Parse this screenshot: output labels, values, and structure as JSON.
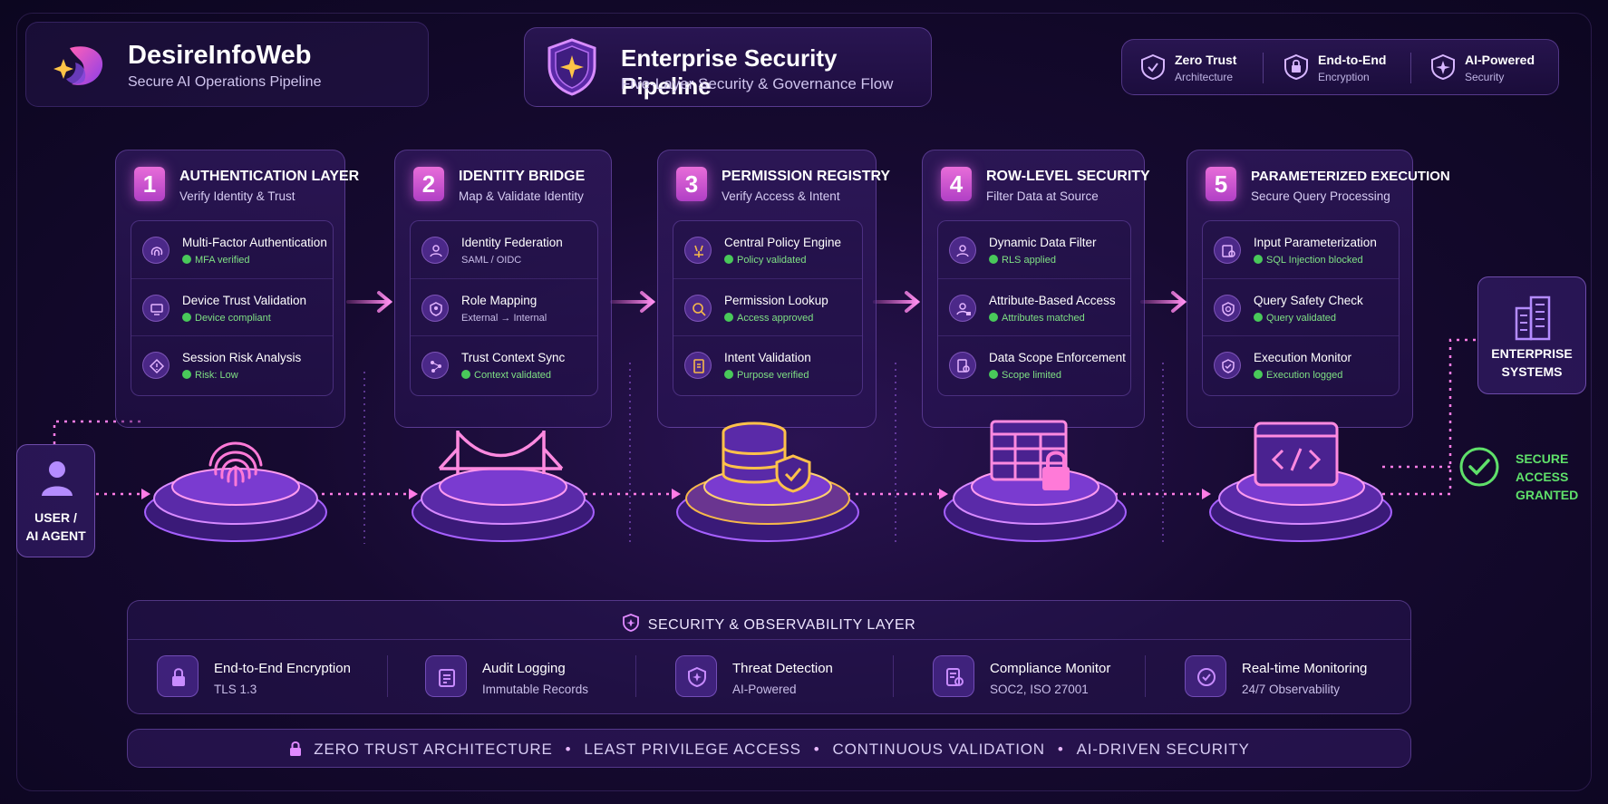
{
  "brand": {
    "name": "DesireInfoWeb",
    "tagline": "Secure AI Operations Pipeline"
  },
  "header": {
    "title": "Enterprise Security Pipeline",
    "subtitle": "Five-Layer Security & Governance Flow"
  },
  "badges": [
    {
      "title": "Zero Trust",
      "sub": "Architecture",
      "icon": "shield-check-icon"
    },
    {
      "title": "End-to-End",
      "sub": "Encryption",
      "icon": "shield-lock-icon"
    },
    {
      "title": "AI-Powered",
      "sub": "Security",
      "icon": "shield-star-icon"
    }
  ],
  "layers": [
    {
      "num": "1",
      "title": "AUTHENTICATION LAYER",
      "subtitle": "Verify Identity & Trust",
      "items": [
        {
          "title": "Multi-Factor Authentication",
          "status": "MFA verified",
          "icon": "fingerprint-icon"
        },
        {
          "title": "Device Trust Validation",
          "status": "Device compliant",
          "icon": "device-icon"
        },
        {
          "title": "Session Risk Analysis",
          "status": "Risk: Low",
          "icon": "risk-icon"
        }
      ]
    },
    {
      "num": "2",
      "title": "IDENTITY BRIDGE",
      "subtitle": "Map & Validate Identity",
      "items": [
        {
          "title": "Identity Federation",
          "status": "SAML / OIDC",
          "icon": "federation-icon"
        },
        {
          "title": "Role Mapping",
          "status": "External → Internal",
          "icon": "role-icon"
        },
        {
          "title": "Trust Context Sync",
          "status": "Context validated",
          "icon": "sync-icon"
        }
      ]
    },
    {
      "num": "3",
      "title": "PERMISSION REGISTRY",
      "subtitle": "Verify Access & Intent",
      "items": [
        {
          "title": "Central Policy Engine",
          "status": "Policy validated",
          "icon": "policy-icon"
        },
        {
          "title": "Permission Lookup",
          "status": "Access approved",
          "icon": "search-icon"
        },
        {
          "title": "Intent Validation",
          "status": "Purpose verified",
          "icon": "document-icon"
        }
      ]
    },
    {
      "num": "4",
      "title": "ROW-LEVEL SECURITY",
      "subtitle": "Filter Data at Source",
      "items": [
        {
          "title": "Dynamic Data Filter",
          "status": "RLS applied",
          "icon": "filter-icon"
        },
        {
          "title": "Attribute-Based Access",
          "status": "Attributes matched",
          "icon": "user-lock-icon"
        },
        {
          "title": "Data Scope Enforcement",
          "status": "Scope limited",
          "icon": "scope-icon"
        }
      ]
    },
    {
      "num": "5",
      "title": "PARAMETERIZED EXECUTION",
      "subtitle": "Secure Query Processing",
      "items": [
        {
          "title": "Input Parameterization",
          "status": "SQL Injection blocked",
          "icon": "input-icon"
        },
        {
          "title": "Query Safety Check",
          "status": "Query validated",
          "icon": "shield-search-icon"
        },
        {
          "title": "Execution Monitor",
          "status": "Execution logged",
          "icon": "monitor-icon"
        }
      ]
    }
  ],
  "user": {
    "line1": "USER /",
    "line2": "AI AGENT"
  },
  "enterprise": {
    "line1": "ENTERPRISE",
    "line2": "SYSTEMS"
  },
  "access": {
    "line1": "SECURE",
    "line2": "ACCESS",
    "line3": "GRANTED"
  },
  "observability": {
    "title": "SECURITY & OBSERVABILITY LAYER",
    "features": [
      {
        "title": "End-to-End Encryption",
        "sub": "TLS 1.3",
        "icon": "lock-icon"
      },
      {
        "title": "Audit Logging",
        "sub": "Immutable Records",
        "icon": "clipboard-icon"
      },
      {
        "title": "Threat Detection",
        "sub": "AI-Powered",
        "icon": "shield-alert-icon"
      },
      {
        "title": "Compliance Monitor",
        "sub": "SOC2, ISO 27001",
        "icon": "compliance-icon"
      },
      {
        "title": "Real-time Monitoring",
        "sub": "24/7 Observability",
        "icon": "clock-icon"
      }
    ]
  },
  "footer": {
    "items": [
      "ZERO TRUST ARCHITECTURE",
      "LEAST PRIVILEGE ACCESS",
      "CONTINUOUS VALIDATION",
      "AI-DRIVEN SECURITY"
    ]
  },
  "colors": {
    "accent": "#c65cf0",
    "pink": "#ff6fe0",
    "success": "#5fe06a",
    "gold": "#f6b84a"
  }
}
